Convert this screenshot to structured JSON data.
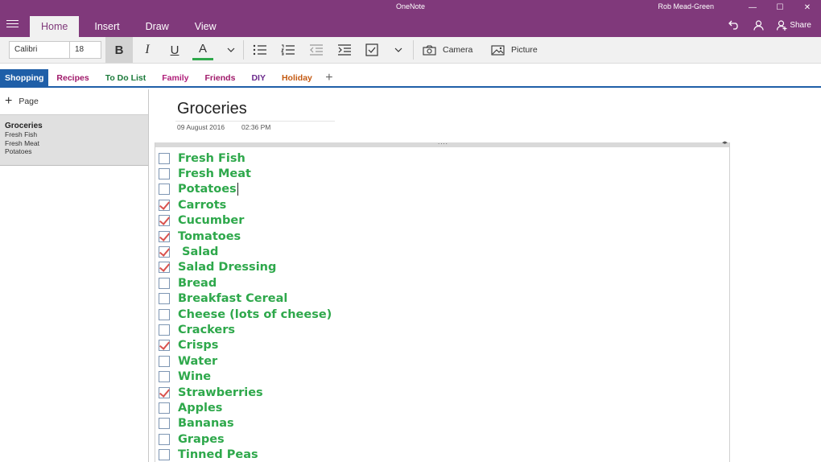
{
  "window": {
    "app_title": "OneNote",
    "user_name": "Rob Mead-Green",
    "minimize": "—",
    "maximize": "☐",
    "close": "✕"
  },
  "ribbon_tabs": [
    "Home",
    "Insert",
    "Draw",
    "View"
  ],
  "toolbar": {
    "share_label": "Share",
    "font_name": "Calibri",
    "font_size": "18",
    "bold": "B",
    "italic": "I",
    "underline": "U",
    "font_color": "A",
    "camera_label": "Camera",
    "picture_label": "Picture"
  },
  "sections": [
    {
      "label": "Shopping",
      "color": "#1f5fa8"
    },
    {
      "label": "Recipes",
      "color": "#a0196a"
    },
    {
      "label": "To Do List",
      "color": "#1b7a3a"
    },
    {
      "label": "Family",
      "color": "#b01e7a"
    },
    {
      "label": "Friends",
      "color": "#a0196a"
    },
    {
      "label": "DIY",
      "color": "#6b2a8c"
    },
    {
      "label": "Holiday",
      "color": "#c45a12"
    }
  ],
  "sidebar": {
    "add_page_label": "Page",
    "page_title": "Groceries",
    "page_preview": [
      "Fresh Fish",
      "Fresh Meat",
      "Potatoes"
    ]
  },
  "page": {
    "title": "Groceries",
    "date": "09 August 2016",
    "time": "02:36 PM"
  },
  "todos": [
    {
      "text": "Fresh Fish",
      "checked": false
    },
    {
      "text": "Fresh Meat",
      "checked": false
    },
    {
      "text": "Potatoes",
      "checked": false
    },
    {
      "text": "Carrots",
      "checked": true
    },
    {
      "text": "Cucumber",
      "checked": true
    },
    {
      "text": "Tomatoes",
      "checked": true
    },
    {
      "text": " Salad",
      "checked": true
    },
    {
      "text": "Salad Dressing",
      "checked": true
    },
    {
      "text": "Bread",
      "checked": false
    },
    {
      "text": "Breakfast Cereal",
      "checked": false
    },
    {
      "text": "Cheese (lots of cheese)",
      "checked": false
    },
    {
      "text": "Crackers",
      "checked": false
    },
    {
      "text": "Crisps",
      "checked": true
    },
    {
      "text": "Water",
      "checked": false
    },
    {
      "text": "Wine",
      "checked": false
    },
    {
      "text": "Strawberries",
      "checked": true
    },
    {
      "text": "Apples",
      "checked": false
    },
    {
      "text": "Bananas",
      "checked": false
    },
    {
      "text": "Grapes",
      "checked": false
    },
    {
      "text": "Tinned Peas",
      "checked": false
    }
  ],
  "colors": {
    "title_bar": "#80397b",
    "todo_text": "#2ea84b",
    "check_mark": "#d9534f"
  }
}
